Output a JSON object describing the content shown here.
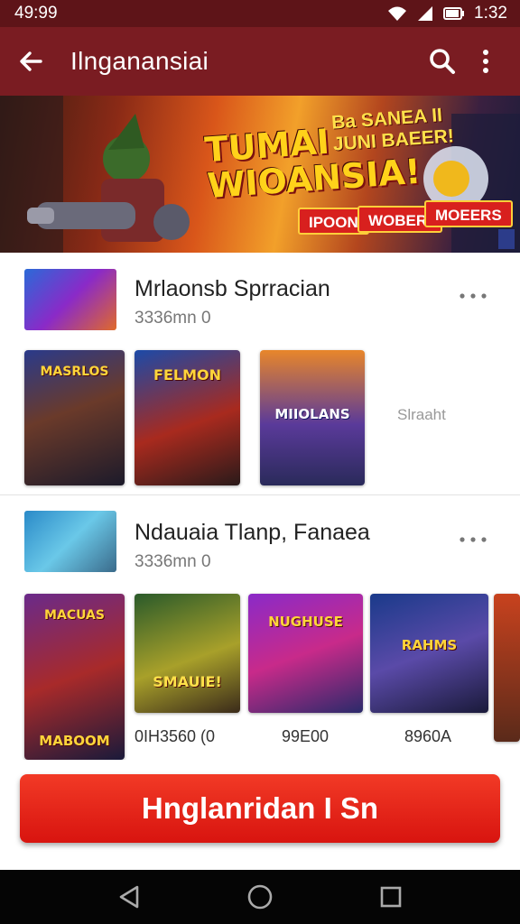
{
  "status_bar": {
    "time_left": "49:99",
    "time_right": "1:32",
    "icons": [
      "wifi-icon",
      "signal-icon",
      "battery-icon"
    ]
  },
  "app_bar": {
    "title": "Ilnganansiai",
    "back_icon": "arrow-left-icon",
    "search_icon": "search-icon",
    "more_icon": "more-vertical-icon"
  },
  "banner": {
    "title_line1": "TUMAI",
    "title_line2": "WIOANSIA!",
    "tag_line1": "Ba SANEA II",
    "tag_line2": "JUNI BAEER!",
    "pill1": "IPOON",
    "pill2": "WOBER.",
    "pill3": "MOEERS"
  },
  "sections": [
    {
      "title": "Mrlaonsb  Sprracian",
      "subtitle": "3336mn 0",
      "more_label": "Slraaht",
      "cards": [
        {
          "title": "MASRLOS",
          "accent": "#2c6a3a"
        },
        {
          "title": "FELMON",
          "accent": "#8a2416"
        },
        {
          "title": "MIIOLANS",
          "accent": "#3a3a8a"
        }
      ]
    },
    {
      "title": "Ndauaia Tlanp, Fanaea",
      "subtitle": "3336mn 0",
      "cards": [
        {
          "title": "MACUAS",
          "price": ""
        },
        {
          "title": "SMAUIE!",
          "price": "0IH3560 (0"
        },
        {
          "title": "NUGHUSE",
          "price": "99E00"
        },
        {
          "title": "RAHMS",
          "price": "8960A"
        }
      ],
      "bottom_badge": "MABOOM"
    }
  ],
  "cta": {
    "label": "Hnglanridan I Sn"
  },
  "colors": {
    "app_bar": "#7a1c22",
    "status_bar": "#5e1418",
    "cta": "#e3221a"
  }
}
